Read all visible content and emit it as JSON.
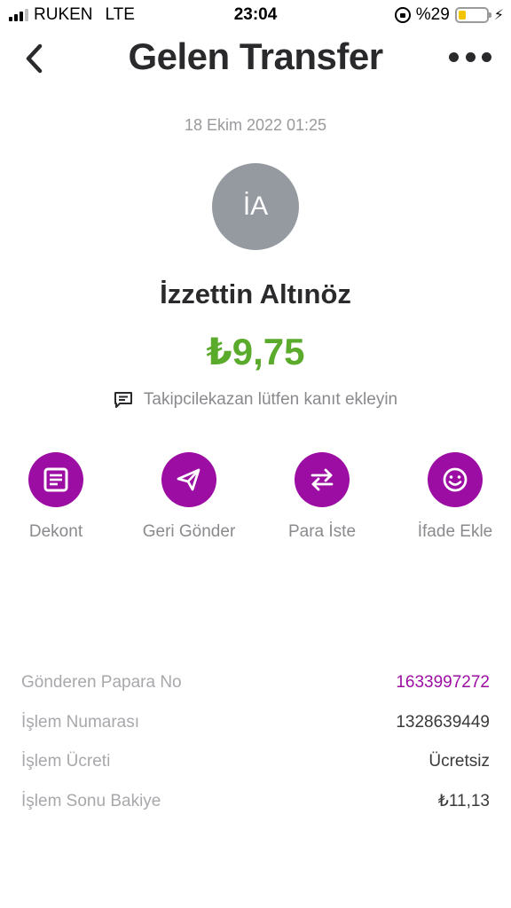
{
  "status_bar": {
    "carrier": "RUKEN",
    "network": "LTE",
    "time": "23:04",
    "battery": "%29",
    "battery_level": 0.29,
    "battery_color": "#f2c500"
  },
  "nav": {
    "title": "Gelen Transfer",
    "back_icon": "chevron-left-icon",
    "more_icon": "more-horizontal-icon"
  },
  "transaction": {
    "date": "18 Ekim 2022 01:25",
    "avatar_initials": "İA",
    "sender_name": "İzzettin Altınöz",
    "amount": "₺9,75",
    "note": "Takipcilekazan lütfen kanıt ekleyin"
  },
  "actions": [
    {
      "label": "Dekont",
      "icon": "receipt-icon"
    },
    {
      "label": "Geri Gönder",
      "icon": "send-icon"
    },
    {
      "label": "Para İste",
      "icon": "swap-arrows-icon"
    },
    {
      "label": "İfade Ekle",
      "icon": "smiley-icon"
    }
  ],
  "details": [
    {
      "key": "Gönderen Papara No",
      "value": "1633997272"
    },
    {
      "key": "İşlem Numarası",
      "value": "1328639449"
    },
    {
      "key": "İşlem Ücreti",
      "value": "Ücretsiz"
    },
    {
      "key": "İşlem Sonu Bakiye",
      "value": "₺11,13"
    }
  ],
  "colors": {
    "accent": "#9c0ea3",
    "amount": "#5aaa2c",
    "avatar": "#949aa0"
  }
}
